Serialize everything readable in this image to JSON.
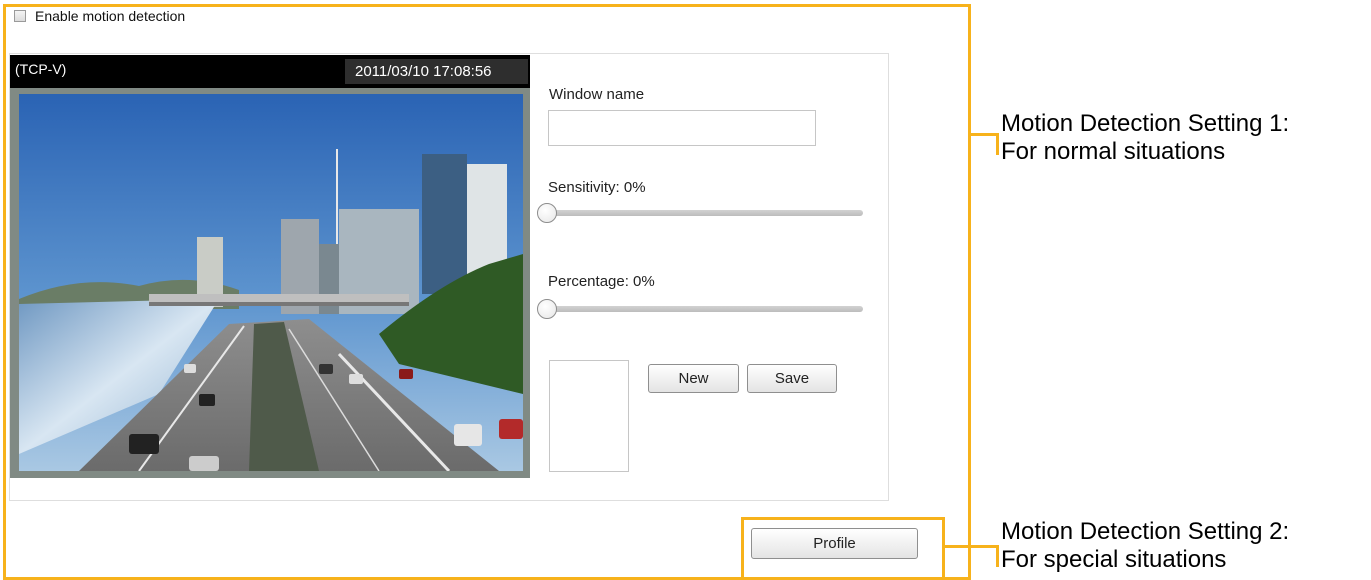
{
  "enable_motion": {
    "label": "Enable motion detection",
    "checked": false
  },
  "video": {
    "title": "(TCP-V)",
    "timestamp": "2011/03/10  17:08:56"
  },
  "window_name": {
    "label": "Window name",
    "value": ""
  },
  "sensitivity": {
    "label": "Sensitivity: 0%",
    "value": 0
  },
  "percentage": {
    "label": "Percentage: 0%",
    "value": 0
  },
  "buttons": {
    "new": "New",
    "save": "Save",
    "profile": "Profile"
  },
  "annotations": {
    "setting1_line1": "Motion Detection Setting 1:",
    "setting1_line2": "For normal situations",
    "setting2_line1": "Motion Detection Setting 2:",
    "setting2_line2": "For special situations"
  },
  "colors": {
    "highlight_frame": "#f7b21b"
  }
}
